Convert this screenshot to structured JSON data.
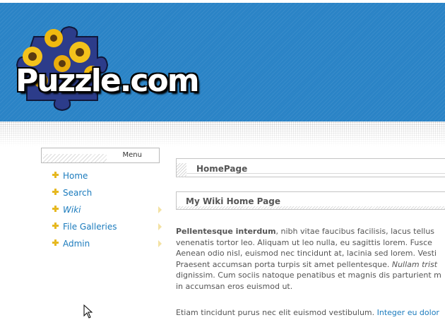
{
  "header": {
    "logo_text": "Puzzle.com",
    "colors": {
      "background": "#2a83c6",
      "accent": "#e6b820"
    }
  },
  "sidebar": {
    "menu_title": "Menu",
    "items": [
      {
        "label": "Home",
        "style": "normal",
        "has_submenu": false
      },
      {
        "label": "Search",
        "style": "normal",
        "has_submenu": false
      },
      {
        "label": "Wiki",
        "style": "italic",
        "has_submenu": true
      },
      {
        "label": "File Galleries",
        "style": "normal",
        "has_submenu": true
      },
      {
        "label": "Admin",
        "style": "normal",
        "has_submenu": true
      }
    ]
  },
  "main": {
    "page_title": "HomePage",
    "heading": "My Wiki Home Page",
    "paragraph1": {
      "bold_start": "Pellentesque interdum",
      "line1_rest": ", nibh vitae faucibus facilisis, lacus tellus",
      "line2": "venenatis tortor leo. Aliquam ut leo nulla, eu sagittis lorem. Fusce",
      "line3": "Aenean odio nisl, euismod nec tincidunt at, lacinia sed lorem. Vesti",
      "line4_start": "Praesent accumsan porta turpis sit amet pellentesque. ",
      "line4_italic": "Nullam trist",
      "line5": "dignissim. Cum sociis natoque penatibus et magnis dis parturient m",
      "line6": "in accumsan eros euismod ut."
    },
    "paragraph2": {
      "text": "Etiam tincidunt purus nec elit euismod vestibulum. ",
      "link": "Integer eu dolor"
    }
  }
}
